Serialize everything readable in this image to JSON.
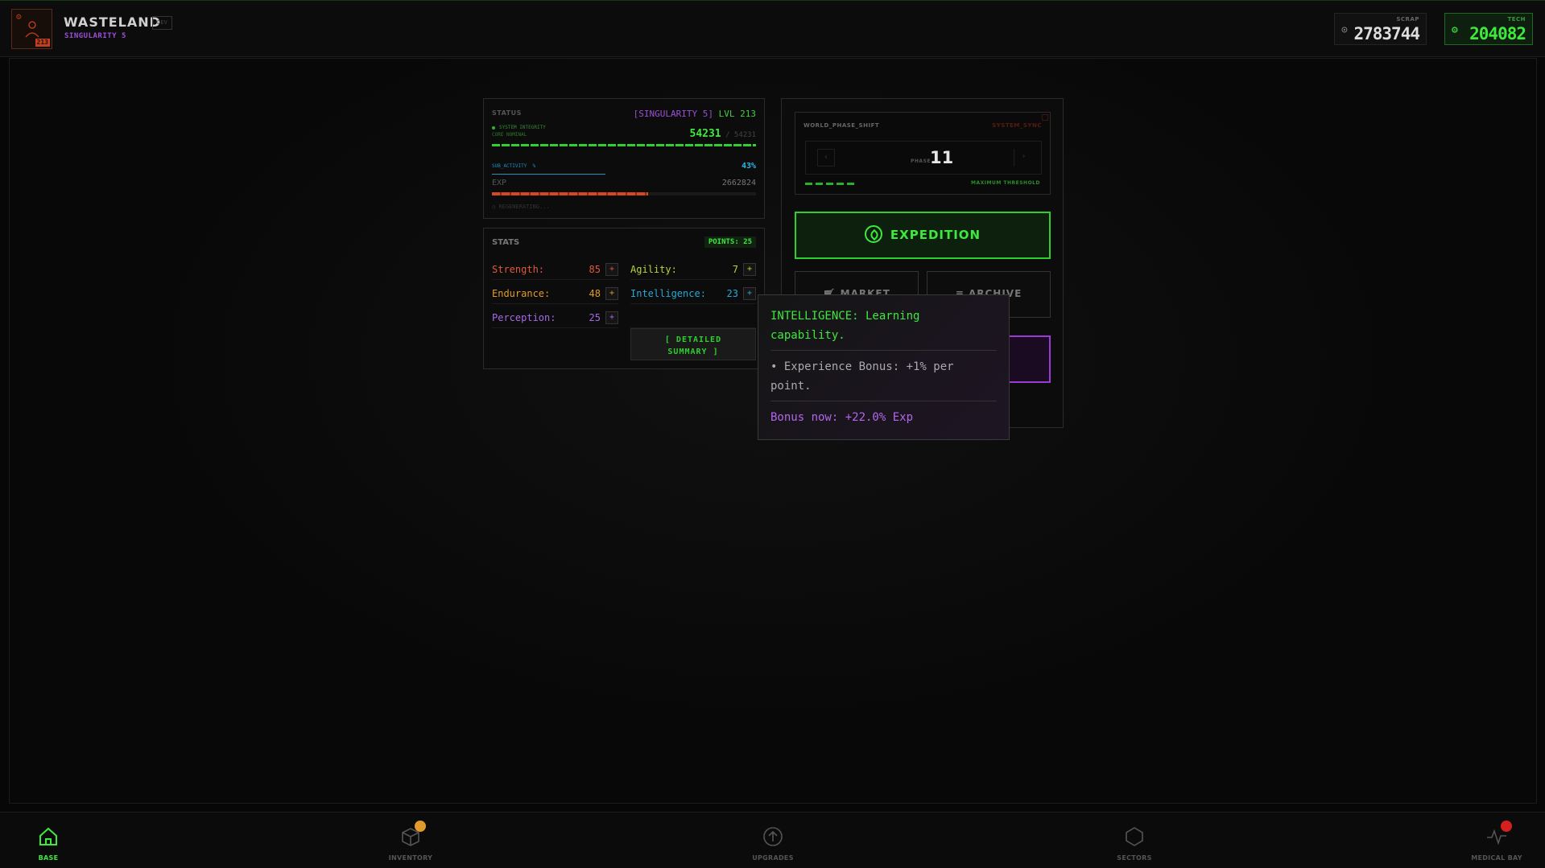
{
  "header": {
    "avatar_level": "213",
    "title": "WASTELAND",
    "tag": "DEV",
    "subtitle": "SINGULARITY 5",
    "resources": {
      "scrap_label": "SCRAP",
      "scrap_value": "2783744",
      "tech_label": "TECH",
      "tech_value": "204082"
    }
  },
  "status": {
    "title": "STATUS",
    "singularity": "[SINGULARITY 5]",
    "level": "LVL 213",
    "integrity_label": "SYSTEM INTEGRITY",
    "integrity_sub": "CORE NOMINAL",
    "hp_current": "54231",
    "hp_max": "/ 54231",
    "sub_label": "SUB_ACTIVITY",
    "sub_pct_symbol": "%",
    "sub_value": "43%",
    "sub_fraction": 0.43,
    "exp_label": "EXP",
    "exp_value": "2662824",
    "exp_fraction": 0.59,
    "regen": "REGENERATING..."
  },
  "stats": {
    "title": "STATS",
    "points": "POINTS: 25",
    "strength": {
      "label": "Strength:",
      "value": "85"
    },
    "endurance": {
      "label": "Endurance:",
      "value": "48"
    },
    "perception": {
      "label": "Perception:",
      "value": "25"
    },
    "agility": {
      "label": "Agility:",
      "value": "7"
    },
    "intelligence": {
      "label": "Intelligence:",
      "value": "23"
    },
    "plus": "+",
    "detailed_1": "[ DETAILED",
    "detailed_2": "SUMMARY ]"
  },
  "world": {
    "phase_title": "WORLD_PHASE_SHIFT",
    "sync": "SYSTEM_SYNC",
    "phase_label": "PHASE",
    "phase_value": "11",
    "prev": "‹",
    "next": "›",
    "threshold": "MAXIMUM THRESHOLD",
    "expedition": "EXPEDITION",
    "market": "MARKET",
    "archive": "ARCHIVE"
  },
  "tooltip": {
    "title": "INTELLIGENCE: Learning capability.",
    "body": "• Experience Bonus: +1% per point.",
    "bonus": "Bonus now: +22.0% Exp"
  },
  "nav": {
    "base": "BASE",
    "inventory": "INVENTORY",
    "upgrades": "UPGRADES",
    "sectors": "SECTORS",
    "medical": "MEDICAL BAY"
  },
  "colors": {
    "accent_green": "#3ee83e",
    "accent_purple": "#9b4fd6",
    "accent_orange": "#d6481f",
    "accent_cyan": "#29a8d6"
  }
}
